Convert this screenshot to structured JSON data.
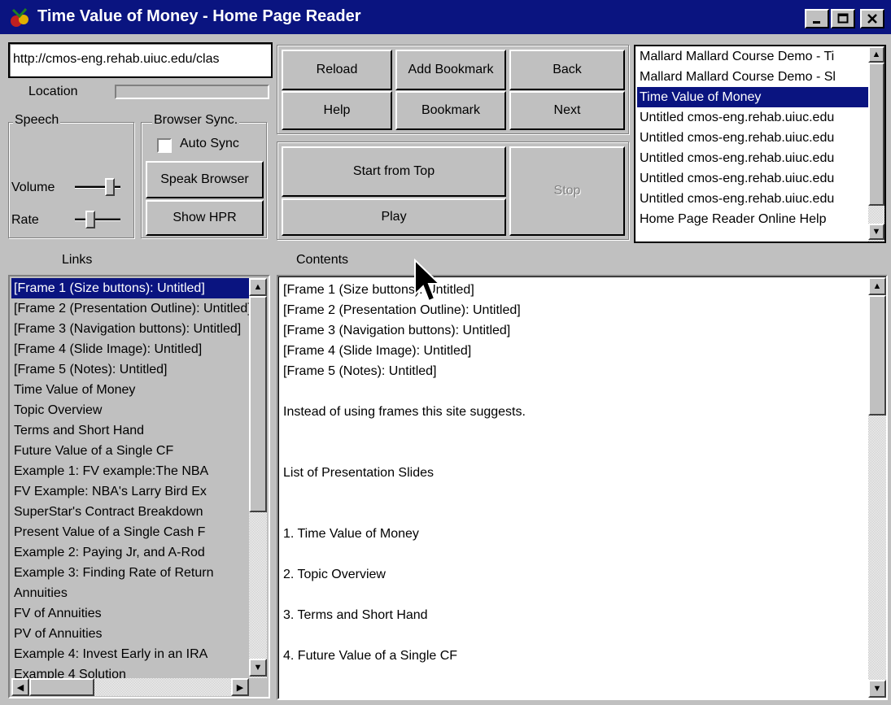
{
  "window": {
    "title": "Time Value of Money - Home Page Reader",
    "controls": [
      "_",
      "□",
      "✕"
    ]
  },
  "address": {
    "value": "http://cmos-eng.rehab.uiuc.edu/clas",
    "location_label": "Location"
  },
  "speech": {
    "group_label": "Speech",
    "volume_label": "Volume",
    "rate_label": "Rate",
    "volume_level": 0.85,
    "rate_level": 0.3
  },
  "browser_sync": {
    "group_label": "Browser Sync.",
    "auto_sync_label": "Auto Sync",
    "auto_sync_checked": false,
    "speak_browser_label": "Speak Browser",
    "show_hpr_label": "Show HPR"
  },
  "nav_buttons": {
    "reload": "Reload",
    "add_bookmark": "Add Bookmark",
    "back": "Back",
    "help": "Help",
    "bookmark": "Bookmark",
    "next": "Next"
  },
  "playback": {
    "start_from_top": "Start from Top",
    "play": "Play",
    "stop": "Stop"
  },
  "history": {
    "items": [
      "Mallard Mallard Course Demo - Ti",
      "Mallard Mallard Course Demo - Sl",
      "Time Value of Money",
      "Untitled cmos-eng.rehab.uiuc.edu",
      "Untitled cmos-eng.rehab.uiuc.edu",
      "Untitled cmos-eng.rehab.uiuc.edu",
      "Untitled cmos-eng.rehab.uiuc.edu",
      "Untitled cmos-eng.rehab.uiuc.edu",
      "Home Page Reader Online Help"
    ],
    "selected_index": 2
  },
  "links": {
    "label": "Links",
    "items": [
      "[Frame 1 (Size buttons): Untitled]",
      "[Frame 2 (Presentation Outline): Untitled]",
      "[Frame 3 (Navigation buttons): Untitled]",
      "[Frame 4 (Slide Image): Untitled]",
      "[Frame 5 (Notes): Untitled]",
      "Time Value of Money",
      "Topic Overview",
      "Terms and Short Hand",
      "Future Value of a Single CF",
      "Example 1: FV example:The NBA",
      "FV Example: NBA's Larry Bird Ex",
      "SuperStar's Contract Breakdown",
      "Present Value of a Single Cash F",
      "Example 2: Paying Jr, and A-Rod",
      "Example 3: Finding Rate of Return",
      "Annuities",
      "FV of Annuities",
      "PV of Annuities",
      "Example 4: Invest Early in an IRA",
      "Example 4 Solution"
    ],
    "selected_index": 0
  },
  "contents": {
    "label": "Contents",
    "lines": [
      "[Frame 1 (Size buttons): Untitled]",
      "[Frame 2 (Presentation Outline): Untitled]",
      "[Frame 3 (Navigation buttons): Untitled]",
      "[Frame 4 (Slide Image): Untitled]",
      "[Frame 5 (Notes): Untitled]",
      "",
      "Instead of using frames this site suggests.",
      "",
      "",
      "List of Presentation Slides",
      "",
      "",
      "1. Time Value of Money",
      "",
      "2. Topic Overview",
      "",
      "3. Terms and Short Hand",
      "",
      "4. Future Value of a Single CF"
    ]
  }
}
